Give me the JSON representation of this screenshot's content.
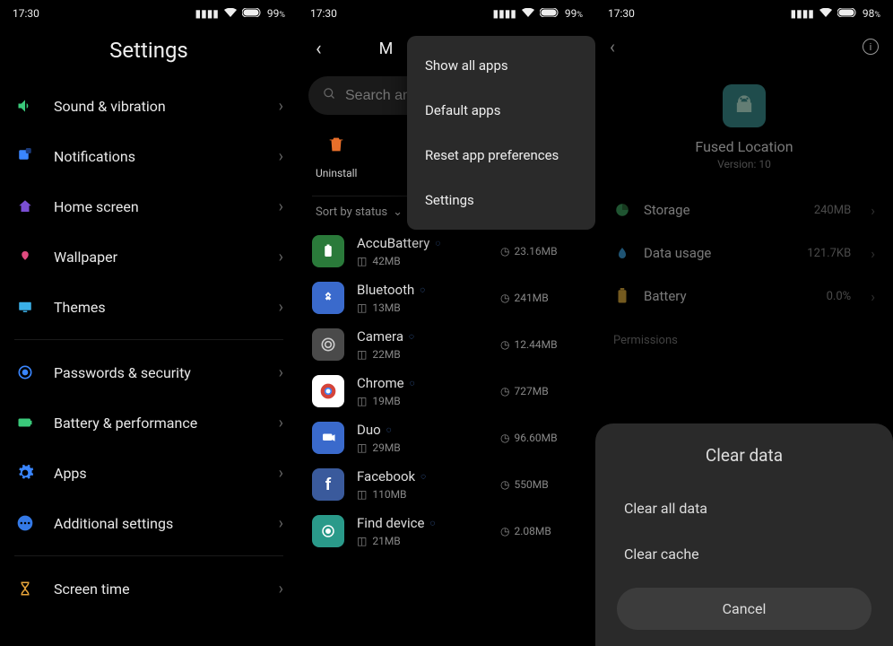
{
  "status": {
    "time": "17:30",
    "battery1": "99",
    "battery2": "99",
    "battery3": "98",
    "pct": "%"
  },
  "panel1": {
    "title": "Settings",
    "items": [
      {
        "label": "Sound & vibration",
        "icon": "volume"
      },
      {
        "label": "Notifications",
        "icon": "notification"
      },
      {
        "label": "Home screen",
        "icon": "home"
      },
      {
        "label": "Wallpaper",
        "icon": "wallpaper"
      },
      {
        "label": "Themes",
        "icon": "themes"
      },
      {
        "sep": true
      },
      {
        "label": "Passwords & security",
        "icon": "security"
      },
      {
        "label": "Battery & performance",
        "icon": "battery"
      },
      {
        "label": "Apps",
        "icon": "apps"
      },
      {
        "label": "Additional settings",
        "icon": "more"
      },
      {
        "sep": true
      },
      {
        "label": "Screen time",
        "icon": "timer"
      }
    ]
  },
  "panel2": {
    "title_partial": "M",
    "search_placeholder": "Search am",
    "uninstall_label": "Uninstall",
    "sort_label": "Sort by status",
    "menu": {
      "show_all": "Show all apps",
      "default_apps": "Default apps",
      "reset_prefs": "Reset app preferences",
      "settings": "Settings"
    },
    "apps": [
      {
        "name": "AccuBattery",
        "storage": "42MB",
        "time": "23.16MB",
        "bg": "#2a7a3a"
      },
      {
        "name": "Bluetooth",
        "storage": "13MB",
        "time": "241MB",
        "bg": "#3a6acc"
      },
      {
        "name": "Camera",
        "storage": "22MB",
        "time": "12.44MB",
        "bg": "#4a4a4a"
      },
      {
        "name": "Chrome",
        "storage": "19MB",
        "time": "727MB",
        "bg": "#d4443a"
      },
      {
        "name": "Duo",
        "storage": "29MB",
        "time": "96.60MB",
        "bg": "#3a6acc"
      },
      {
        "name": "Facebook",
        "storage": "110MB",
        "time": "550MB",
        "bg": "#3a5a9c"
      },
      {
        "name": "Find device",
        "storage": "21MB",
        "time": "2.08MB",
        "bg": "#2a9a8a"
      }
    ]
  },
  "panel3": {
    "app_name": "Fused Location",
    "version_label": "Version: 10",
    "rows": {
      "storage": {
        "label": "Storage",
        "value": "240MB"
      },
      "data": {
        "label": "Data usage",
        "value": "121.7KB"
      },
      "battery": {
        "label": "Battery",
        "value": "0.0%"
      }
    },
    "perm_section": "Permissions",
    "sheet": {
      "title": "Clear data",
      "clear_all": "Clear all data",
      "clear_cache": "Clear cache",
      "cancel": "Cancel"
    }
  }
}
